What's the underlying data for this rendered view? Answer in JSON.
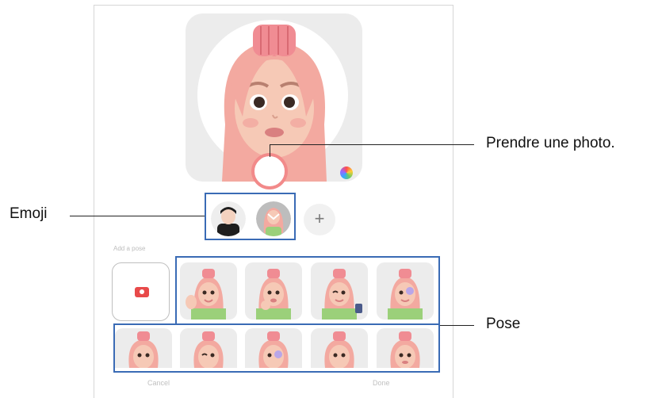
{
  "callouts": {
    "take_photo": "Prendre une photo.",
    "emoji": "Emoji",
    "pose": "Pose"
  },
  "phone": {
    "add_pose_label": "Add a pose",
    "cancel_label": "Cancel",
    "done_label": "Done",
    "add_emoji_symbol": "+"
  },
  "icons": {
    "camera": "camera-icon",
    "color_palette": "color-wheel-icon",
    "add": "plus-icon"
  },
  "colors": {
    "highlight_border": "#3a6bb5",
    "shutter_ring": "#f28a8a",
    "camera_red": "#e84a4a",
    "hair_pink": "#f3a9a0",
    "skin": "#f6c9b6"
  }
}
